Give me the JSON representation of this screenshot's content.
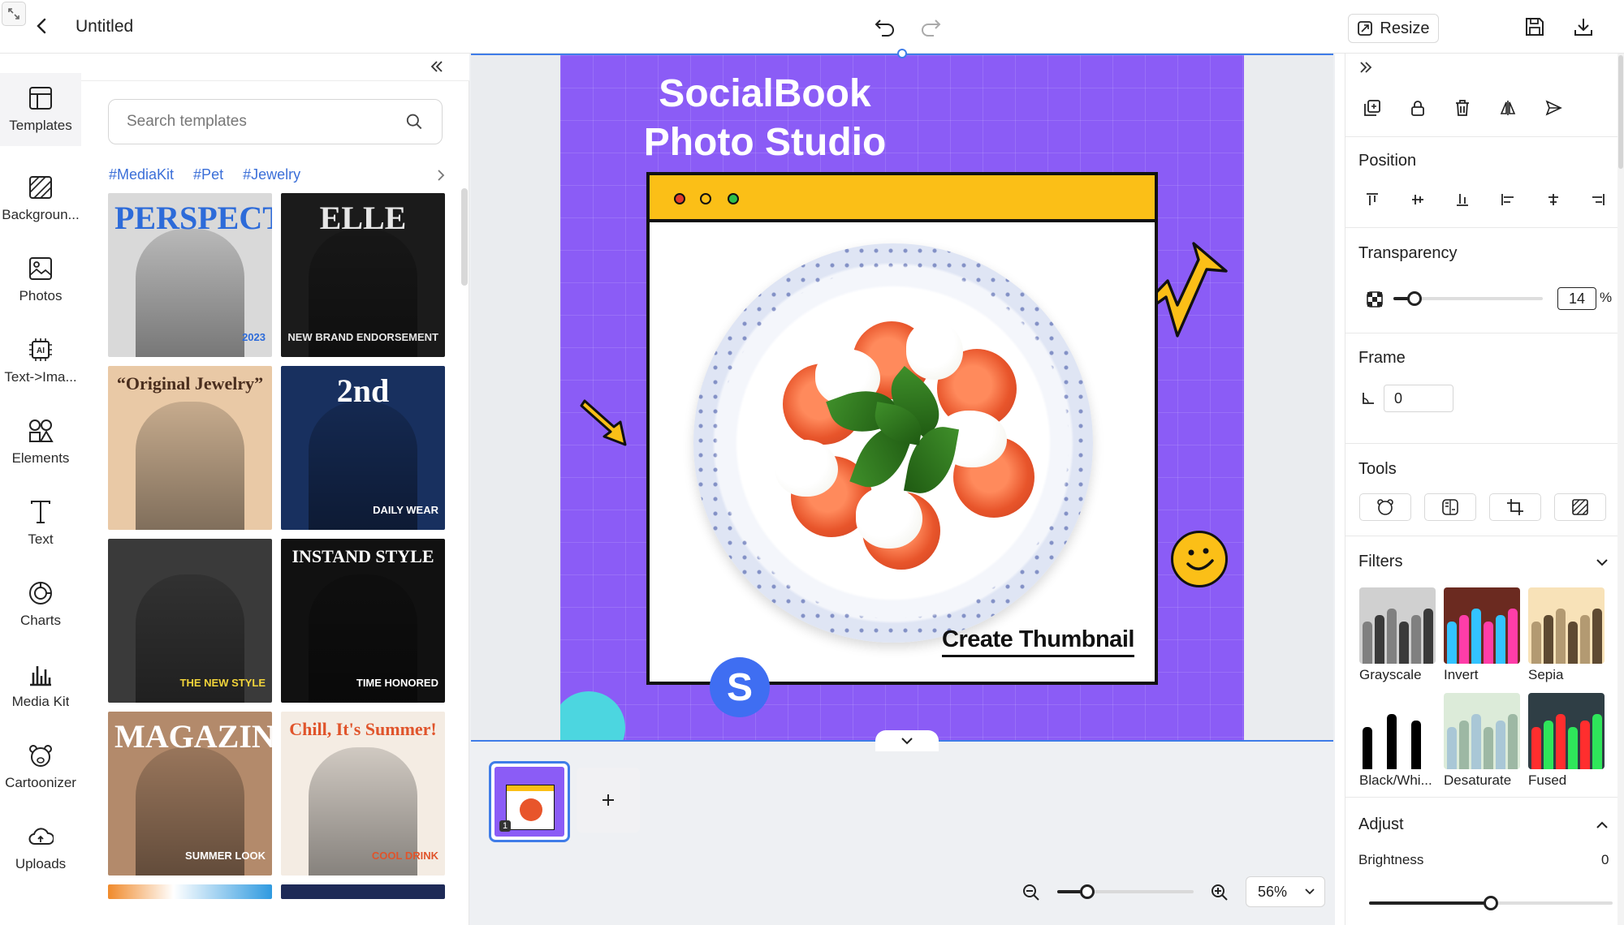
{
  "header": {
    "title": "Untitled",
    "resize_label": "Resize"
  },
  "rail": {
    "items": [
      {
        "label": "Templates",
        "icon": "layout-icon",
        "active": true
      },
      {
        "label": "Backgroun...",
        "icon": "background-icon"
      },
      {
        "label": "Photos",
        "icon": "photo-icon"
      },
      {
        "label": "Text->Ima...",
        "icon": "ai-chip-icon"
      },
      {
        "label": "Elements",
        "icon": "shapes-icon"
      },
      {
        "label": "Text",
        "icon": "text-icon"
      },
      {
        "label": "Charts",
        "icon": "chart-circle-icon"
      },
      {
        "label": "Media Kit",
        "icon": "bar-chart-icon"
      },
      {
        "label": "Cartoonizer",
        "icon": "bear-icon"
      },
      {
        "label": "Uploads",
        "icon": "cloud-upload-icon"
      }
    ]
  },
  "templates": {
    "search_placeholder": "Search templates",
    "tags": [
      "#MediaKit",
      "#Pet",
      "#Jewelry"
    ],
    "cards": [
      {
        "caption": "PERSPECTIVE",
        "sub": "2023",
        "bg": "#d9d9d9",
        "fg": "#2d6bd9"
      },
      {
        "caption": "ELLE",
        "sub": "NEW BRAND ENDORSEMENT",
        "bg": "#1b1b1b",
        "fg": "#e6e6e6"
      },
      {
        "caption": "“Original Jewelry”",
        "sub": "",
        "bg": "#e9c9a6",
        "fg": "#4a2e1e"
      },
      {
        "caption": "2nd",
        "sub": "DAILY WEAR",
        "bg": "#18305f",
        "fg": "#ffffff"
      },
      {
        "caption": "",
        "sub": "THE NEW STYLE",
        "bg": "#3a3a3a",
        "fg": "#f2d43a"
      },
      {
        "caption": "INSTAND STYLE",
        "sub": "TIME HONORED",
        "bg": "#111111",
        "fg": "#ffffff"
      },
      {
        "caption": "MAGAZINE",
        "sub": "SUMMER LOOK",
        "bg": "#b38a6b",
        "fg": "#ffffff"
      },
      {
        "caption": "Chill, It's Summer!",
        "sub": "COOL DRINK",
        "bg": "#f4ece3",
        "fg": "#e0542b"
      }
    ]
  },
  "canvas": {
    "title": "SocialBook Photo Studio",
    "caption": "Create Thumbnail",
    "logo_letter": "S",
    "bg_color": "#8b5cf6",
    "accent_color": "#fbbf17"
  },
  "pages": {
    "current": "1"
  },
  "zoom": {
    "value": "56%",
    "level": 0.22
  },
  "props": {
    "position_heading": "Position",
    "transparency_heading": "Transparency",
    "transparency_value": "14",
    "transparency_unit": "%",
    "transparency_level": 0.14,
    "frame_heading": "Frame",
    "frame_value": "0",
    "tools_heading": "Tools",
    "filters_heading": "Filters",
    "filters": [
      {
        "label": "Grayscale",
        "colors": [
          "#d0d0d0",
          "#808080",
          "#3a3a3a"
        ]
      },
      {
        "label": "Invert",
        "colors": [
          "#6b2a20",
          "#33c3ff",
          "#ff3da8"
        ]
      },
      {
        "label": "Sepia",
        "colors": [
          "#f8e2b8",
          "#b39a72",
          "#5e4a32"
        ]
      },
      {
        "label": "Black/Whi...",
        "colors": [
          "#ffffff",
          "#000000",
          "#ffffff"
        ]
      },
      {
        "label": "Desaturate",
        "colors": [
          "#dcebd9",
          "#a9c7d6",
          "#9db8a4"
        ]
      },
      {
        "label": "Fused",
        "colors": [
          "#2f3e45",
          "#ff2e2e",
          "#2ee65a"
        ]
      }
    ],
    "adjust_heading": "Adjust",
    "brightness_label": "Brightness",
    "brightness_value": "0",
    "brightness_level": 0.5
  }
}
